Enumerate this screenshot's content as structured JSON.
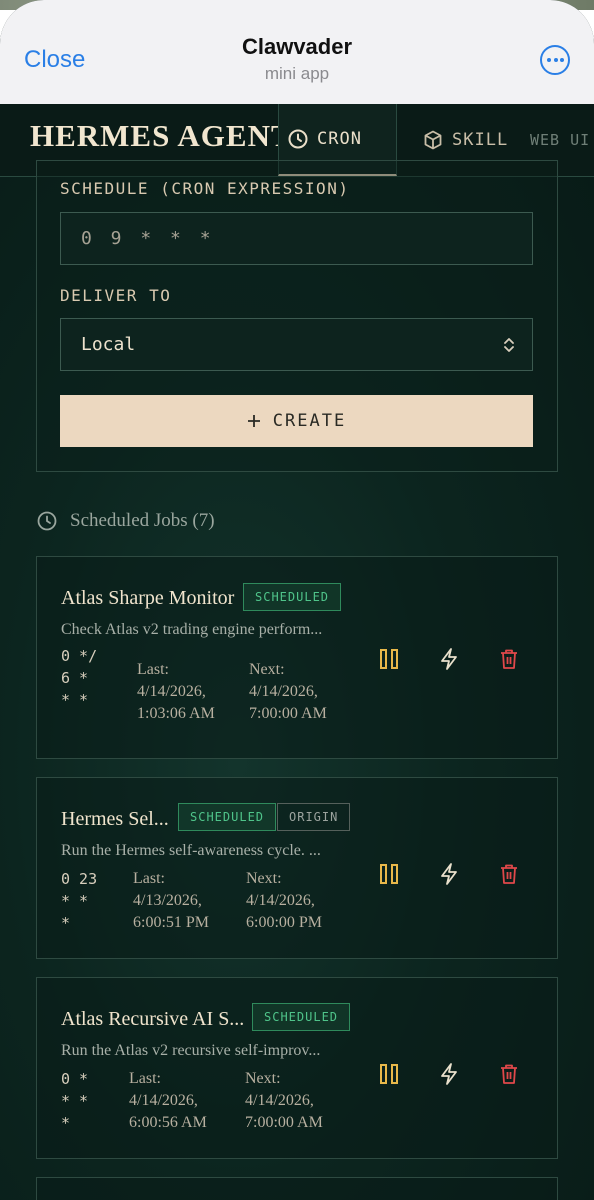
{
  "sheet": {
    "close_label": "Close",
    "title": "Clawvader",
    "subtitle": "mini app"
  },
  "nav": {
    "brand": "HERMES AGENT",
    "tabs": [
      {
        "label": "CRON",
        "icon": "clock-icon",
        "active": true
      },
      {
        "label": "SKILL",
        "icon": "cube-icon",
        "active": false
      },
      {
        "label": "WEB UI",
        "icon": "",
        "active": false
      }
    ]
  },
  "form": {
    "schedule_label": "SCHEDULE (CRON EXPRESSION)",
    "schedule_placeholder": "0 9 * * *",
    "deliver_label": "DELIVER TO",
    "deliver_value": "Local",
    "create_label": "CREATE"
  },
  "jobs_header": "Scheduled Jobs (7)",
  "jobs": [
    {
      "name": "Atlas Sharpe Monitor",
      "badges": [
        "SCHEDULED"
      ],
      "description": "Check Atlas v2 trading engine perform...",
      "cron": "0 */6 * * *",
      "last_label": "Last:",
      "last_date": "4/14/2026,",
      "last_time": "1:03:06 AM",
      "next_label": "Next:",
      "next_date": "4/14/2026,",
      "next_time": "7:00:00 AM"
    },
    {
      "name": "Hermes Sel...",
      "badges": [
        "SCHEDULED",
        "ORIGIN"
      ],
      "description": "Run the Hermes self-awareness cycle. ...",
      "cron": "0 23 * * *",
      "last_label": "Last:",
      "last_date": "4/13/2026,",
      "last_time": "6:00:51 PM",
      "next_label": "Next:",
      "next_date": "4/14/2026,",
      "next_time": "6:00:00 PM"
    },
    {
      "name": "Atlas Recursive AI S...",
      "badges": [
        "SCHEDULED"
      ],
      "description": "Run the Atlas v2 recursive self-improv...",
      "cron": "0 * * * *",
      "last_label": "Last:",
      "last_date": "4/14/2026,",
      "last_time": "6:00:56 AM",
      "next_label": "Next:",
      "next_date": "4/14/2026,",
      "next_time": "7:00:00 AM"
    }
  ],
  "colors": {
    "pause": "#e8b84a",
    "run": "#e9e0cc",
    "delete": "#e0484a",
    "accent_blue": "#2a7fe6"
  }
}
